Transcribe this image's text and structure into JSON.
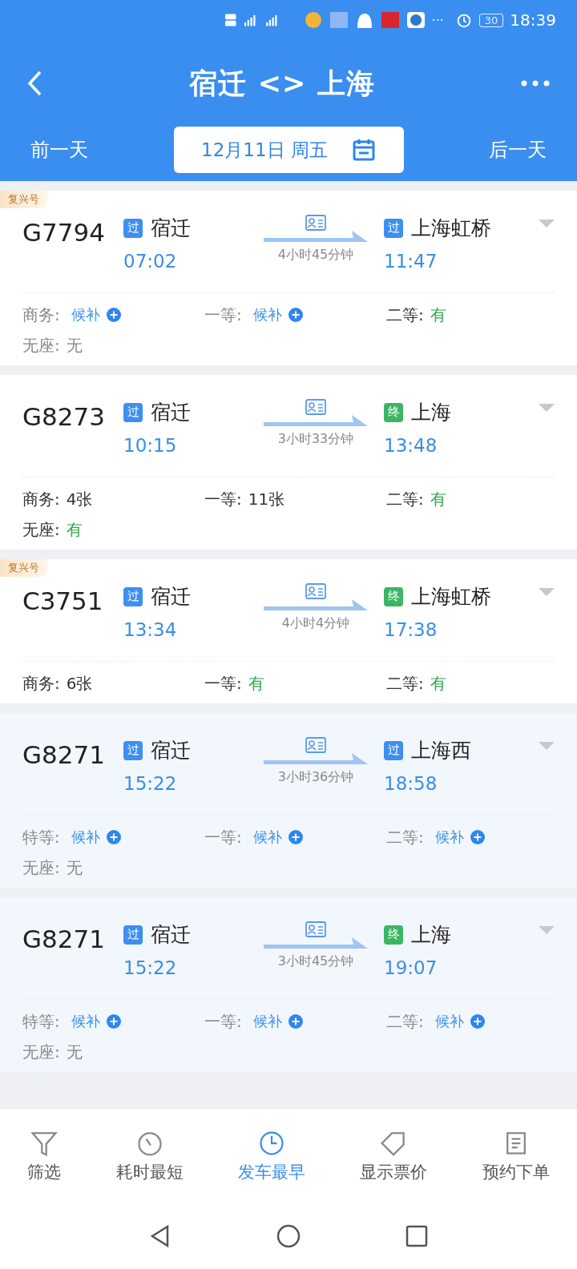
{
  "status_bar": {
    "more": "···",
    "battery": "30",
    "time": "18:39"
  },
  "header": {
    "title": "宿迁 <> 上海",
    "prev_day": "前一天",
    "date": "12月11日 周五",
    "next_day": "后一天"
  },
  "trains": [
    {
      "badge": "复兴号",
      "number": "G7794",
      "highlighted": false,
      "from": {
        "kind": "pass",
        "mark": "过",
        "station": "宿迁",
        "time": "07:02"
      },
      "duration": "4小时45分钟",
      "to": {
        "kind": "pass",
        "mark": "过",
        "station": "上海虹桥",
        "time": "11:47"
      },
      "seats": [
        {
          "label": "商务:",
          "value": "候补",
          "kind": "waitlist"
        },
        {
          "label": "一等:",
          "value": "候补",
          "kind": "waitlist"
        },
        {
          "label": "二等:",
          "value": "有",
          "kind": "available"
        },
        {
          "label": "无座:",
          "value": "无",
          "kind": "none"
        }
      ]
    },
    {
      "number": "G8273",
      "highlighted": false,
      "from": {
        "kind": "pass",
        "mark": "过",
        "station": "宿迁",
        "time": "10:15"
      },
      "duration": "3小时33分钟",
      "to": {
        "kind": "terminal",
        "mark": "终",
        "station": "上海",
        "time": "13:48"
      },
      "seats": [
        {
          "label": "商务:",
          "value": "4张",
          "kind": "count"
        },
        {
          "label": "一等:",
          "value": "11张",
          "kind": "count"
        },
        {
          "label": "二等:",
          "value": "有",
          "kind": "available"
        },
        {
          "label": "无座:",
          "value": "有",
          "kind": "available"
        }
      ]
    },
    {
      "badge": "复兴号",
      "number": "C3751",
      "highlighted": false,
      "from": {
        "kind": "pass",
        "mark": "过",
        "station": "宿迁",
        "time": "13:34"
      },
      "duration": "4小时4分钟",
      "to": {
        "kind": "terminal",
        "mark": "终",
        "station": "上海虹桥",
        "time": "17:38"
      },
      "seats": [
        {
          "label": "商务:",
          "value": "6张",
          "kind": "count"
        },
        {
          "label": "一等:",
          "value": "有",
          "kind": "available"
        },
        {
          "label": "二等:",
          "value": "有",
          "kind": "available"
        }
      ]
    },
    {
      "number": "G8271",
      "highlighted": true,
      "from": {
        "kind": "pass",
        "mark": "过",
        "station": "宿迁",
        "time": "15:22"
      },
      "duration": "3小时36分钟",
      "to": {
        "kind": "pass",
        "mark": "过",
        "station": "上海西",
        "time": "18:58"
      },
      "seats": [
        {
          "label": "特等:",
          "value": "候补",
          "kind": "waitlist"
        },
        {
          "label": "一等:",
          "value": "候补",
          "kind": "waitlist"
        },
        {
          "label": "二等:",
          "value": "候补",
          "kind": "waitlist"
        },
        {
          "label": "无座:",
          "value": "无",
          "kind": "none"
        }
      ]
    },
    {
      "number": "G8271",
      "highlighted": true,
      "from": {
        "kind": "pass",
        "mark": "过",
        "station": "宿迁",
        "time": "15:22"
      },
      "duration": "3小时45分钟",
      "to": {
        "kind": "terminal",
        "mark": "终",
        "station": "上海",
        "time": "19:07"
      },
      "seats": [
        {
          "label": "特等:",
          "value": "候补",
          "kind": "waitlist"
        },
        {
          "label": "一等:",
          "value": "候补",
          "kind": "waitlist"
        },
        {
          "label": "二等:",
          "value": "候补",
          "kind": "waitlist"
        },
        {
          "label": "无座:",
          "value": "无",
          "kind": "none"
        }
      ]
    }
  ],
  "toolbar": [
    {
      "label": "筛选",
      "kind": "filter",
      "selected": false
    },
    {
      "label": "耗时最短",
      "kind": "timer",
      "selected": false
    },
    {
      "label": "发车最早",
      "kind": "clock",
      "selected": true
    },
    {
      "label": "显示票价",
      "kind": "tag",
      "selected": false
    },
    {
      "label": "预约下单",
      "kind": "list",
      "selected": false
    }
  ]
}
